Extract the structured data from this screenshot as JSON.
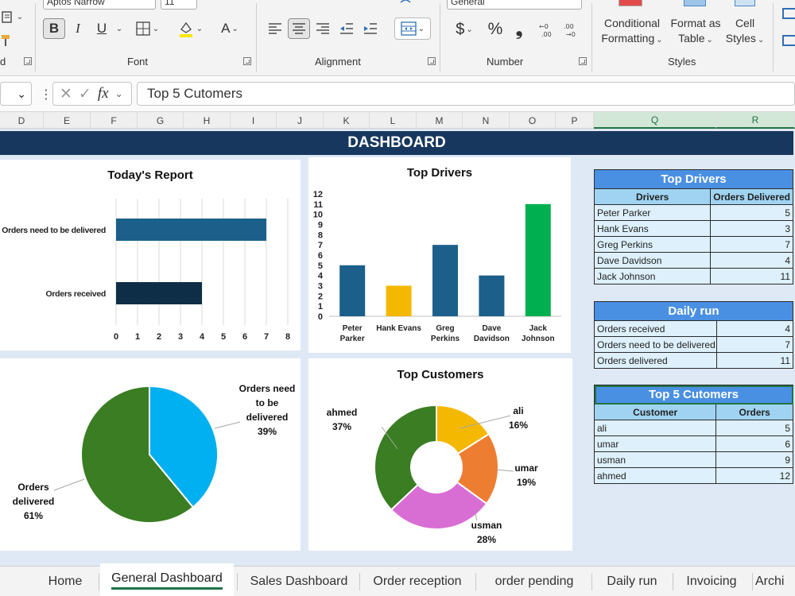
{
  "ribbon": {
    "font_name": "Aptos Narrow",
    "font_size": "11",
    "number_format": "General",
    "bold": "B",
    "italic": "I",
    "underline": "U",
    "font_color": "A",
    "currency": "$",
    "percent": "%",
    "comma": "❟",
    "groups": {
      "font": "Font",
      "alignment": "Alignment",
      "number": "Number",
      "styles": "Styles"
    },
    "conditional_formatting": [
      "Conditional",
      "Formatting"
    ],
    "format_as_table": [
      "Format as",
      "Table"
    ],
    "cell_styles": [
      "Cell",
      "Styles"
    ]
  },
  "formula_bar": {
    "fx": "fx",
    "content": "Top 5 Cutomers"
  },
  "columns": [
    "D",
    "E",
    "F",
    "G",
    "H",
    "I",
    "J",
    "K",
    "L",
    "M",
    "N",
    "O",
    "P",
    "Q",
    "R"
  ],
  "dashboard": {
    "title": "DASHBOARD",
    "todays_report": {
      "title": "Today's Report",
      "categories": [
        "Orders need to be delivered",
        "Orders received"
      ],
      "values": [
        7,
        4
      ],
      "ticks": [
        "0",
        "1",
        "2",
        "3",
        "4",
        "5",
        "6",
        "7",
        "8"
      ]
    },
    "top_drivers_chart": {
      "title": "Top Drivers",
      "ticks": [
        "0",
        "1",
        "2",
        "3",
        "4",
        "5",
        "6",
        "7",
        "8",
        "9",
        "10",
        "11",
        "12"
      ]
    },
    "pie": {
      "slices": [
        {
          "lines": [
            "Orders need",
            "to be",
            "delivered",
            "39%"
          ]
        },
        {
          "lines": [
            "Orders",
            "delivered",
            "61%"
          ]
        }
      ]
    },
    "top_customers_chart": {
      "title": "Top Customers",
      "labels": [
        {
          "name": "ali",
          "pct": "16%"
        },
        {
          "name": "umar",
          "pct": "19%"
        },
        {
          "name": "usman",
          "pct": "28%"
        },
        {
          "name": "ahmed",
          "pct": "37%"
        }
      ]
    }
  },
  "tables": {
    "top_drivers": {
      "title": "Top Drivers",
      "headers": [
        "Drivers",
        "Orders Delivered"
      ],
      "rows": [
        [
          "Peter Parker",
          "5"
        ],
        [
          "Hank Evans",
          "3"
        ],
        [
          "Greg Perkins",
          "7"
        ],
        [
          "Dave Davidson",
          "4"
        ],
        [
          "Jack Johnson",
          "11"
        ]
      ]
    },
    "daily_run": {
      "title": "Daily run",
      "rows": [
        [
          "Orders received",
          "4"
        ],
        [
          "Orders need to be delivered",
          "7"
        ],
        [
          "Orders delivered",
          "11"
        ]
      ]
    },
    "top_customers": {
      "title": "Top 5 Cutomers",
      "headers": [
        "Customer",
        "Orders"
      ],
      "rows": [
        [
          "ali",
          "5"
        ],
        [
          "umar",
          "6"
        ],
        [
          "usman",
          "9"
        ],
        [
          "ahmed",
          "12"
        ]
      ]
    }
  },
  "sheet_tabs": [
    "Home",
    "General Dashboard",
    "Sales Dashboard",
    "Order reception",
    "order pending",
    "Daily run",
    "Invoicing",
    "Archi"
  ],
  "active_tab": "General Dashboard",
  "chart_data": [
    {
      "type": "bar",
      "orientation": "horizontal",
      "title": "Today's Report",
      "categories": [
        "Orders need to be delivered",
        "Orders received"
      ],
      "values": [
        7,
        4
      ],
      "xlim": [
        0,
        8
      ],
      "colors": [
        "#1b5f8a",
        "#0d2e46"
      ],
      "grid": true
    },
    {
      "type": "bar",
      "title": "Top Drivers",
      "categories": [
        "Peter Parker",
        "Hank Evans",
        "Greg Perkins",
        "Dave Davidson",
        "Jack Johnson"
      ],
      "values": [
        5,
        3,
        7,
        4,
        11
      ],
      "ylim": [
        0,
        12
      ],
      "colors": [
        "#1b5f8a",
        "#f5b800",
        "#1b5f8a",
        "#1b5f8a",
        "#00b050"
      ]
    },
    {
      "type": "pie",
      "labels": [
        "Orders need to be delivered",
        "Orders delivered"
      ],
      "values": [
        39,
        61
      ],
      "colors": [
        "#00b0f0",
        "#3a7d22"
      ]
    },
    {
      "type": "pie",
      "style": "donut",
      "title": "Top Customers",
      "labels": [
        "ali",
        "umar",
        "usman",
        "ahmed"
      ],
      "values": [
        16,
        19,
        28,
        37
      ],
      "colors": [
        "#f5b800",
        "#ed7d31",
        "#d86ed4",
        "#3a7d22"
      ]
    }
  ]
}
